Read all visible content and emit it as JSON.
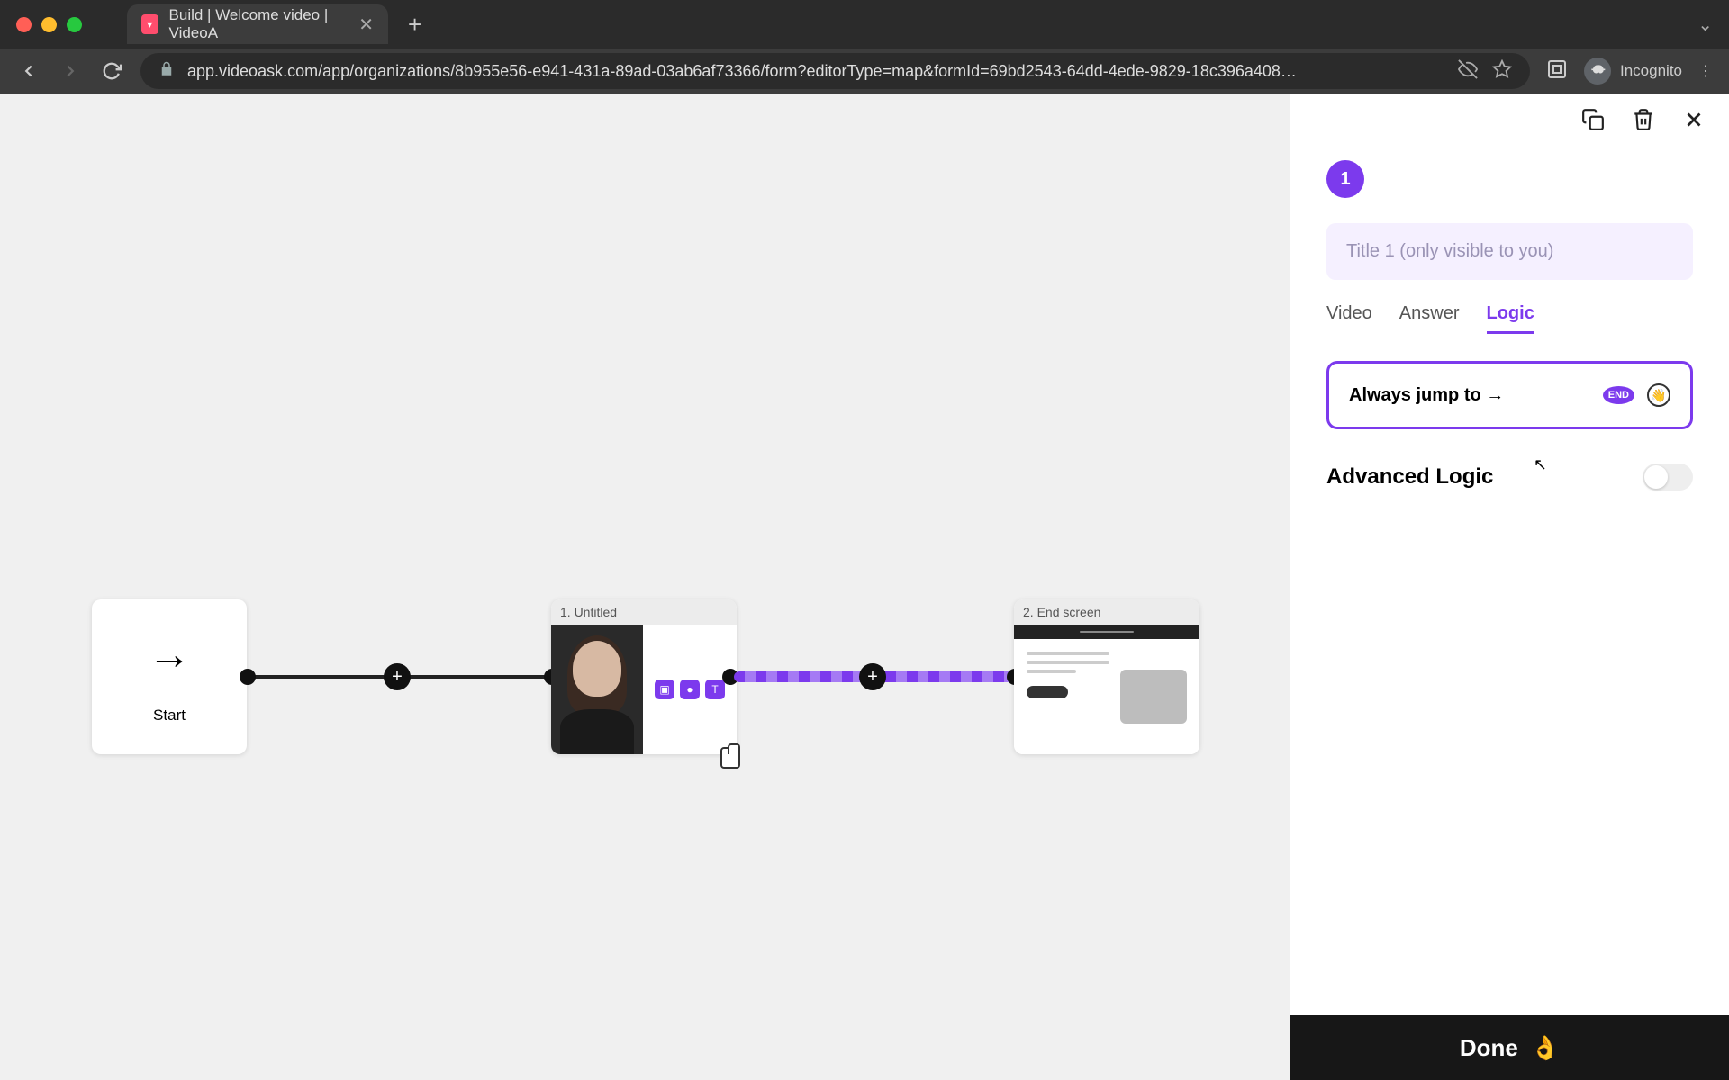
{
  "browser": {
    "tab_title": "Build | Welcome video | VideoA",
    "url": "app.videoask.com/app/organizations/8b955e56-e941-431a-89ad-03ab6af73366/form?editorType=map&formId=69bd2543-64dd-4ede-9829-18c396a408…",
    "incognito_label": "Incognito"
  },
  "canvas": {
    "start_label": "Start",
    "step1_title": "1. Untitled",
    "step2_title": "2. End screen"
  },
  "panel": {
    "step_number": "1",
    "title_placeholder": "Title 1 (only visible to you)",
    "tabs": {
      "video": "Video",
      "answer": "Answer",
      "logic": "Logic"
    },
    "always_jump_label": "Always jump to →",
    "end_badge": "END",
    "advanced_logic_label": "Advanced Logic",
    "done_label": "Done"
  }
}
